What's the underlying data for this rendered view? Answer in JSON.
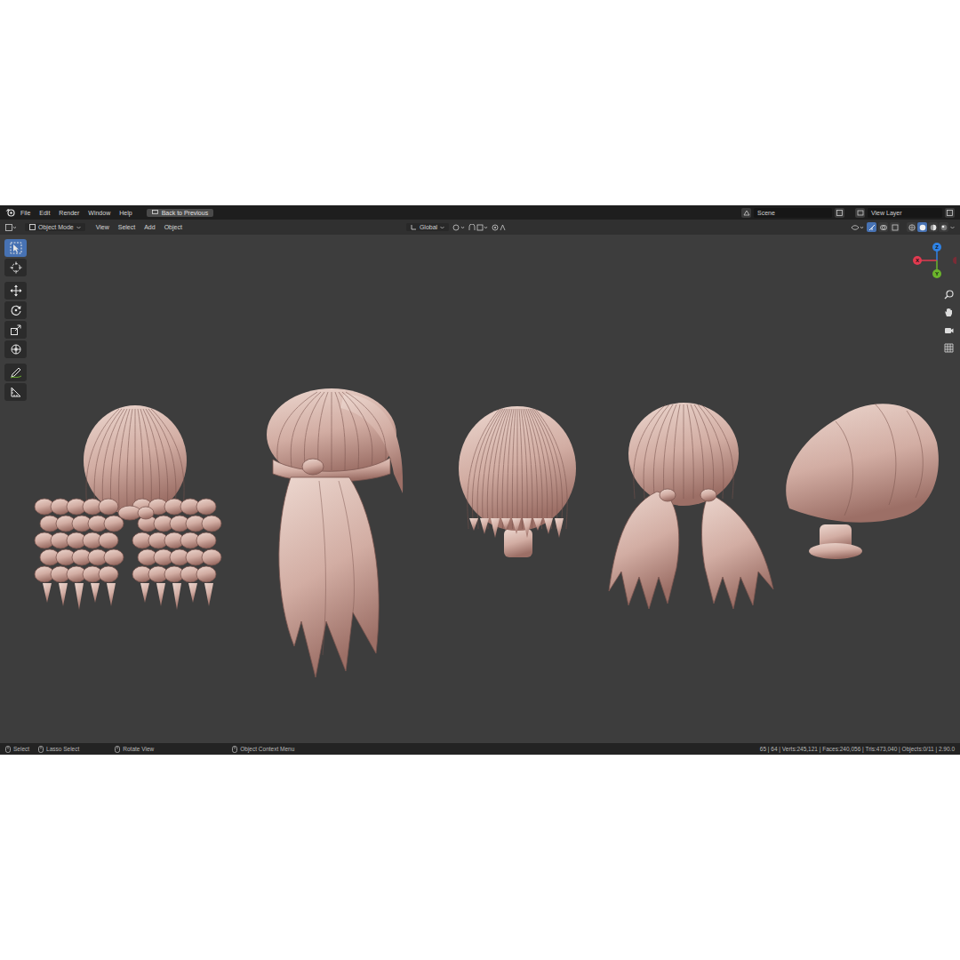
{
  "menu_bar": {
    "items": [
      "File",
      "Edit",
      "Render",
      "Window",
      "Help"
    ],
    "back_button": "Back to Previous",
    "scene": "Scene",
    "view_layer": "View Layer"
  },
  "header": {
    "mode": "Object Mode",
    "menus": [
      "View",
      "Select",
      "Add",
      "Object"
    ],
    "orientation": "Global",
    "shading": [
      {
        "kind": "wireframe",
        "selected": false
      },
      {
        "kind": "solid",
        "selected": true
      },
      {
        "kind": "material",
        "selected": false
      },
      {
        "kind": "rendered",
        "selected": false
      }
    ]
  },
  "toolbar": {
    "tools": [
      {
        "kind": "select",
        "selected": true
      },
      {
        "kind": "cursor",
        "selected": false
      },
      {
        "kind": "move",
        "selected": false
      },
      {
        "kind": "rotate",
        "selected": false
      },
      {
        "kind": "scale",
        "selected": false
      },
      {
        "kind": "transform",
        "selected": false
      },
      {
        "kind": "annotate",
        "selected": false
      },
      {
        "kind": "measure",
        "selected": false
      }
    ]
  },
  "gizmo": {
    "axes": [
      {
        "label": "Z",
        "color": "#2f83e6"
      },
      {
        "label": "X",
        "color": "#e23a50"
      },
      {
        "label": "Y",
        "color": "#6bb52c"
      }
    ]
  },
  "models": [
    {
      "kind": "curly-pigtails"
    },
    {
      "kind": "ponytail"
    },
    {
      "kind": "short"
    },
    {
      "kind": "pigtails"
    },
    {
      "kind": "bob"
    }
  ],
  "status_bar": {
    "hints": [
      "Select",
      "Lasso Select",
      "Rotate View",
      "Object Context Menu"
    ],
    "stats": "65 | 64 | Verts:245,121 | Faces:240,056 | Tris:473,040 | Objects:0/11 | 2.90.0"
  }
}
